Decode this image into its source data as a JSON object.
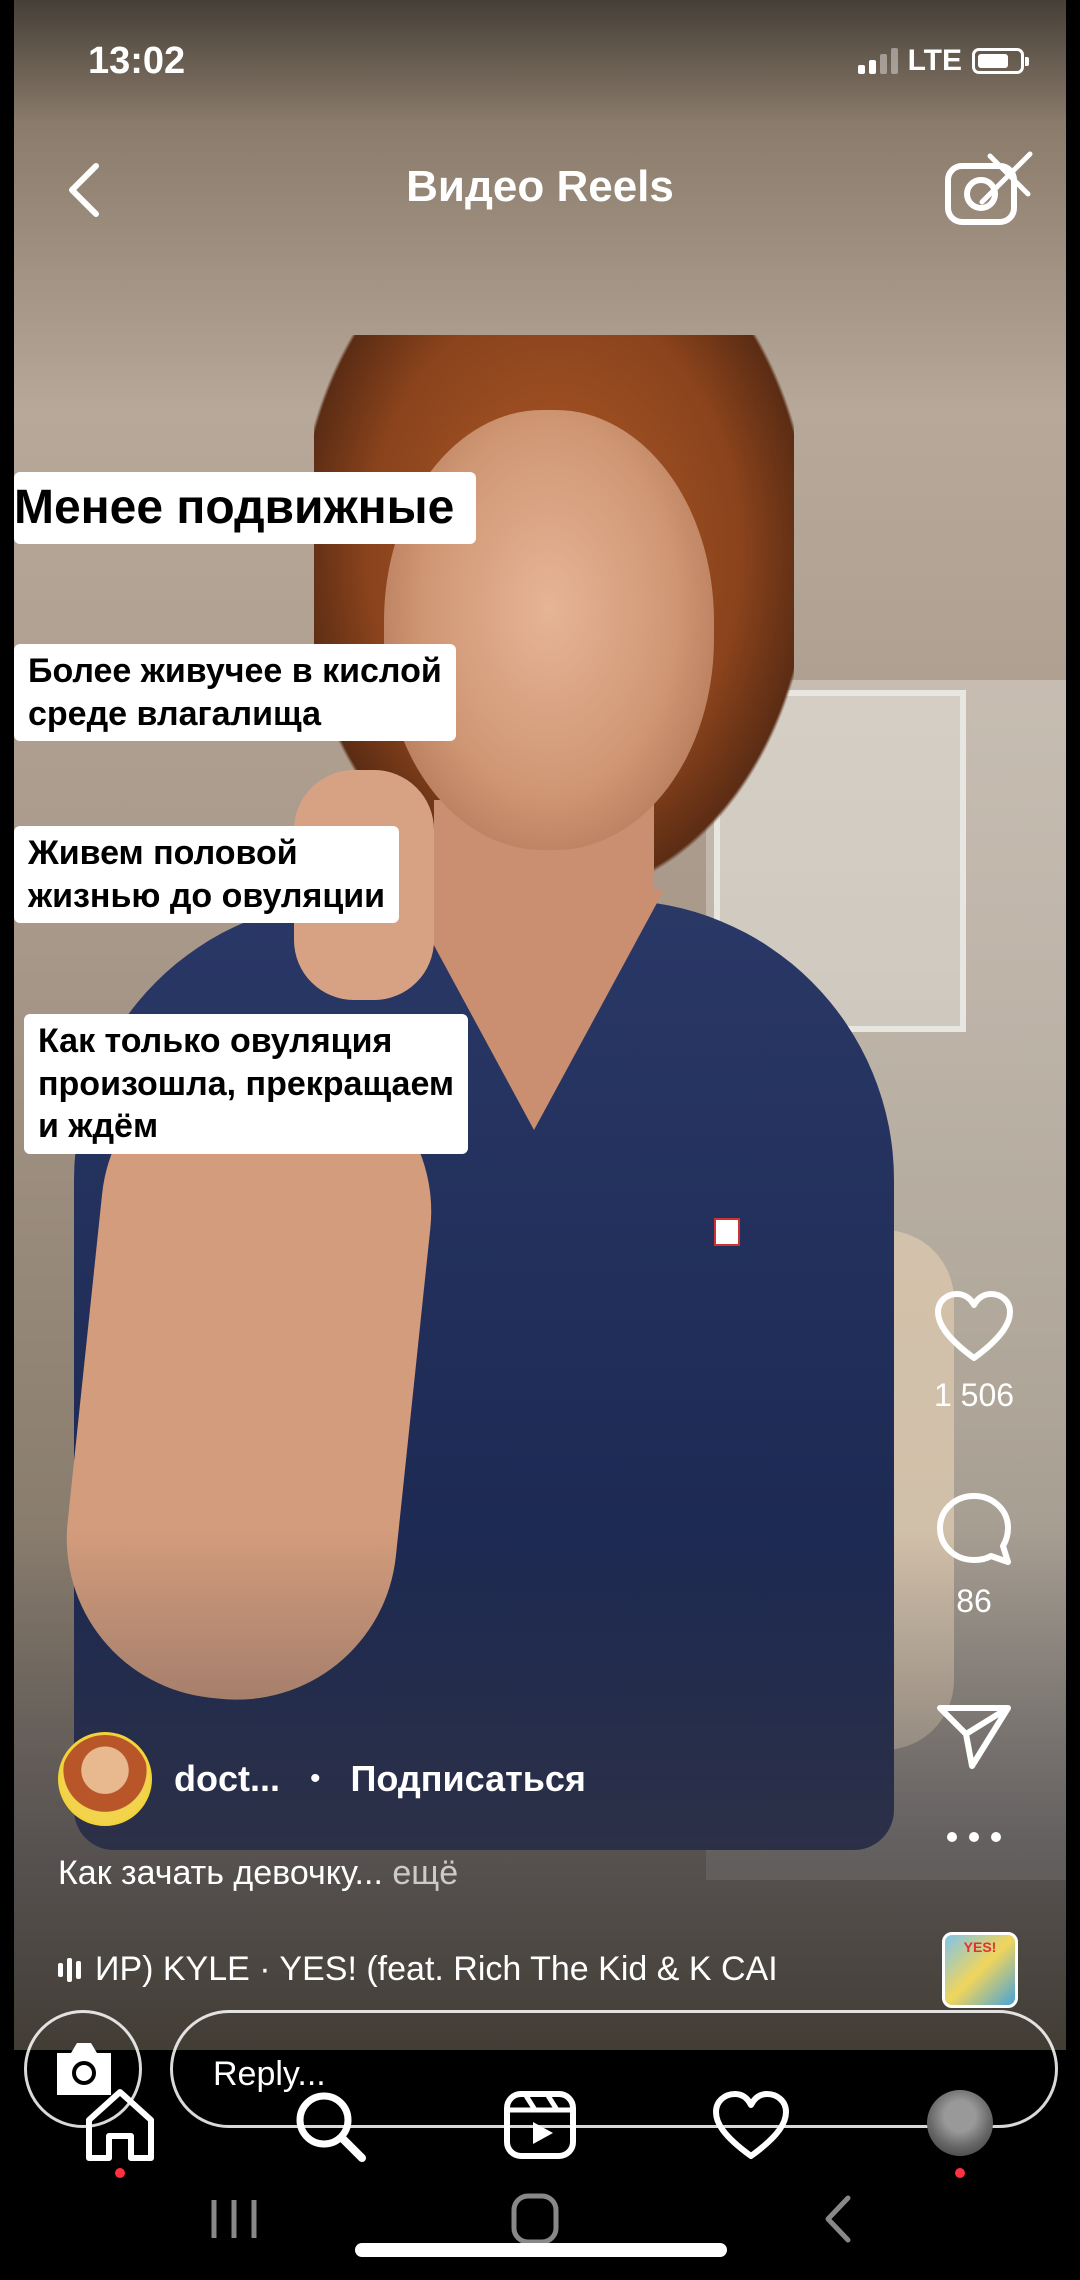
{
  "status_bar": {
    "time": "13:02",
    "network": "LTE"
  },
  "header": {
    "title": "Видео Reels"
  },
  "captions": [
    {
      "lines": [
        "Менее подвижные"
      ]
    },
    {
      "lines": [
        "Более живучее в кислой",
        "среде влагалища"
      ]
    },
    {
      "lines": [
        "Живем половой",
        "жизнью до овуляции"
      ]
    },
    {
      "lines": [
        "Как только овуляция",
        "произошла, прекращаем",
        "и ждём"
      ]
    }
  ],
  "actions": {
    "likes": "1 506",
    "comments": "86"
  },
  "author": {
    "name": "doct...",
    "separator": "•",
    "subscribe": "Подписаться"
  },
  "description": {
    "text": "Как зачать девочку...",
    "more": "ещё"
  },
  "music": {
    "track": "ИP)  KYLE · YES! (feat. Rich The Kid & K CAI",
    "album_text": "YES!"
  },
  "reply": {
    "placeholder": "Reply..."
  },
  "icons": {
    "back": "chevron-left-icon",
    "camera": "camera-off-icon",
    "like": "heart-icon",
    "comment": "comment-icon",
    "send": "send-icon",
    "more": "more-icon",
    "home": "home-icon",
    "search": "search-icon",
    "reels": "reels-icon",
    "activity": "heart-icon",
    "profile": "profile-avatar"
  }
}
